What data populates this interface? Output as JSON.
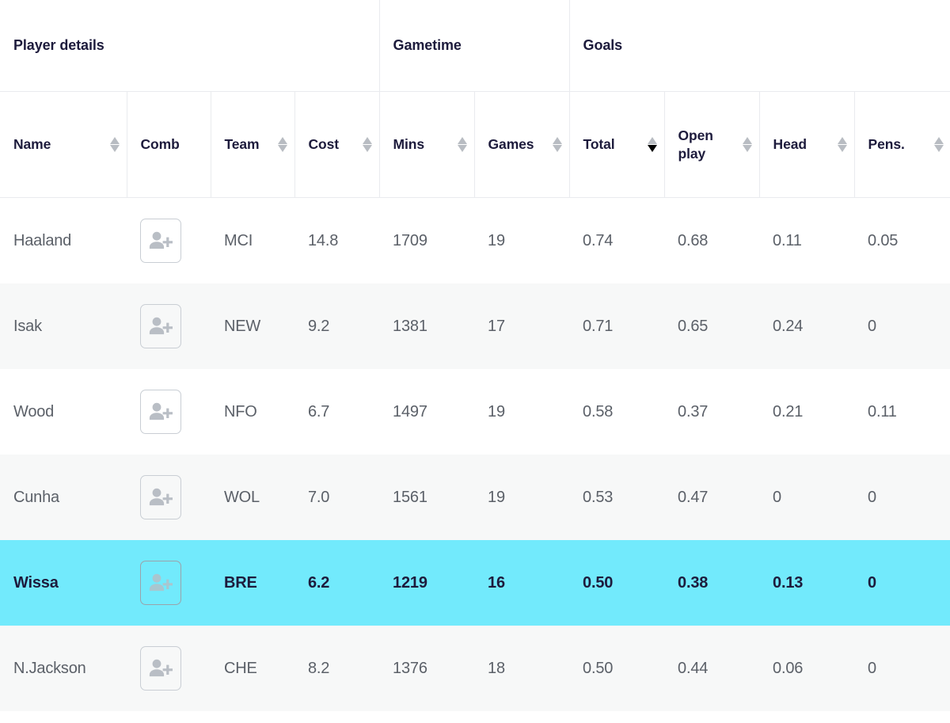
{
  "table": {
    "group_headers": [
      {
        "label": "Player details",
        "span": 4
      },
      {
        "label": "Gametime",
        "span": 2
      },
      {
        "label": "Goals",
        "span": 4
      }
    ],
    "columns": [
      {
        "key": "name",
        "label": "Name",
        "sortable": true,
        "sort": "none"
      },
      {
        "key": "comb",
        "label": "Comb",
        "sortable": false,
        "sort": "none"
      },
      {
        "key": "team",
        "label": "Team",
        "sortable": true,
        "sort": "none"
      },
      {
        "key": "cost",
        "label": "Cost",
        "sortable": true,
        "sort": "none"
      },
      {
        "key": "mins",
        "label": "Mins",
        "sortable": true,
        "sort": "none"
      },
      {
        "key": "games",
        "label": "Games",
        "sortable": true,
        "sort": "none"
      },
      {
        "key": "total",
        "label": "Total",
        "sortable": true,
        "sort": "desc"
      },
      {
        "key": "open_play",
        "label": "Open play",
        "sortable": true,
        "sort": "none"
      },
      {
        "key": "head",
        "label": "Head",
        "sortable": true,
        "sort": "none"
      },
      {
        "key": "pens",
        "label": "Pens.",
        "sortable": true,
        "sort": "none"
      }
    ],
    "add_button_icon": "add-person-icon",
    "rows": [
      {
        "name": "Haaland",
        "team": "MCI",
        "cost": "14.8",
        "mins": "1709",
        "games": "19",
        "total": "0.74",
        "open_play": "0.68",
        "head": "0.11",
        "pens": "0.05",
        "highlighted": false
      },
      {
        "name": "Isak",
        "team": "NEW",
        "cost": "9.2",
        "mins": "1381",
        "games": "17",
        "total": "0.71",
        "open_play": "0.65",
        "head": "0.24",
        "pens": "0",
        "highlighted": false
      },
      {
        "name": "Wood",
        "team": "NFO",
        "cost": "6.7",
        "mins": "1497",
        "games": "19",
        "total": "0.58",
        "open_play": "0.37",
        "head": "0.21",
        "pens": "0.11",
        "highlighted": false
      },
      {
        "name": "Cunha",
        "team": "WOL",
        "cost": "7.0",
        "mins": "1561",
        "games": "19",
        "total": "0.53",
        "open_play": "0.47",
        "head": "0",
        "pens": "0",
        "highlighted": false
      },
      {
        "name": "Wissa",
        "team": "BRE",
        "cost": "6.2",
        "mins": "1219",
        "games": "16",
        "total": "0.50",
        "open_play": "0.38",
        "head": "0.13",
        "pens": "0",
        "highlighted": true
      },
      {
        "name": "N.Jackson",
        "team": "CHE",
        "cost": "8.2",
        "mins": "1376",
        "games": "18",
        "total": "0.50",
        "open_play": "0.44",
        "head": "0.06",
        "pens": "0",
        "highlighted": false
      }
    ]
  },
  "colors": {
    "highlight_row": "#72eafc",
    "header_text": "#1d1b3c",
    "body_text": "#5b6068",
    "grid_line": "#e9ebee",
    "zebra_row": "#f7f8f8",
    "sort_arrow_inactive": "#b8bcc2",
    "sort_arrow_active": "#000000"
  }
}
